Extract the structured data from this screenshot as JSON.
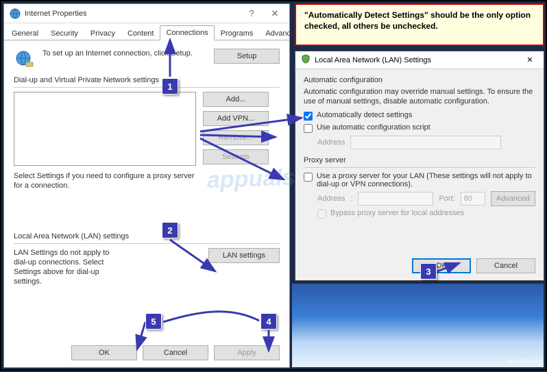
{
  "banner": {
    "text": "\"Automatically Detect Settings\" should be the only option checked, all others be unchecked."
  },
  "ip": {
    "title": "Internet Properties",
    "tabs": {
      "general": "General",
      "security": "Security",
      "privacy": "Privacy",
      "content": "Content",
      "connections": "Connections",
      "programs": "Programs",
      "advanced": "Advanced"
    },
    "setup_desc": "To set up an Internet connection, click Setup.",
    "setup_btn": "Setup",
    "dialup_label": "Dial-up and Virtual Private Network settings",
    "add_btn": "Add...",
    "addvpn_btn": "Add VPN...",
    "remove_btn": "Remove...",
    "settings_btn": "Settings",
    "select_desc": "Select Settings if you need to configure a proxy server for a connection.",
    "lan_grouplabel": "Local Area Network (LAN) settings",
    "lan_desc": "LAN Settings do not apply to dial-up connections. Select Settings above for dial-up settings.",
    "lansettings_btn": "LAN settings",
    "ok": "OK",
    "cancel": "Cancel",
    "apply": "Apply"
  },
  "lan": {
    "title": "Local Area Network (LAN) Settings",
    "auto_title": "Automatic configuration",
    "auto_desc": "Automatic configuration may override manual settings.  To ensure the use of manual settings, disable automatic configuration.",
    "auto_detect": "Automatically detect settings",
    "auto_script": "Use automatic configuration script",
    "address_label": "Address",
    "proxy_title": "Proxy server",
    "proxy_use": "Use a proxy server for your LAN (These settings will not apply to dial-up or VPN connections).",
    "port_label": "Port:",
    "port_value": "80",
    "advanced_btn": "Advanced",
    "bypass": "Bypass proxy server for local addresses",
    "ok": "OK",
    "cancel": "Cancel"
  },
  "markers": {
    "m1": "1",
    "m2": "2",
    "m3": "3",
    "m4": "4",
    "m5": "5"
  },
  "watermark": "appuals",
  "corner": "wsxdn.com"
}
